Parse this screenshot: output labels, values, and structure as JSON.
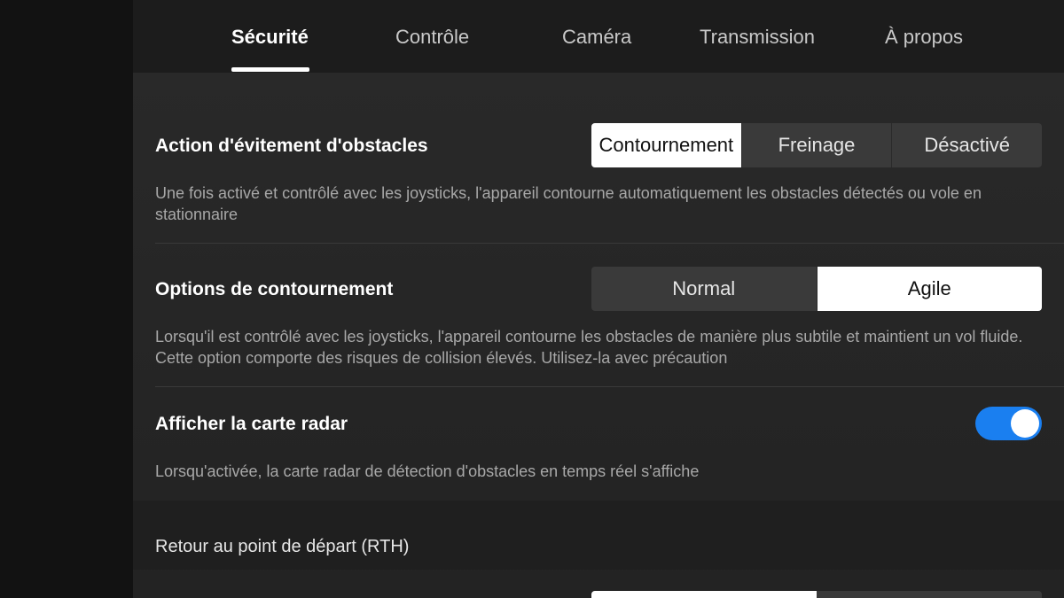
{
  "tabs": [
    {
      "label": "Sécurité",
      "active": true
    },
    {
      "label": "Contrôle",
      "active": false
    },
    {
      "label": "Caméra",
      "active": false
    },
    {
      "label": "Transmission",
      "active": false
    },
    {
      "label": "À propos",
      "active": false
    }
  ],
  "obstacle_action": {
    "title": "Action d'évitement d'obstacles",
    "options": [
      "Contournement",
      "Freinage",
      "Désactivé"
    ],
    "selected": "Contournement",
    "description": "Une fois activé et contrôlé avec les joysticks, l'appareil contourne automatiquement les obstacles détectés ou vole en stationnaire"
  },
  "bypass_options": {
    "title": "Options de contournement",
    "options": [
      "Normal",
      "Agile"
    ],
    "selected": "Agile",
    "description": "Lorsqu'il est contrôlé avec les joysticks, l'appareil contourne les obstacles de manière plus subtile et maintient un vol fluide. Cette option comporte des risques de collision élevés. Utilisez-la avec précaution"
  },
  "radar_map": {
    "title": "Afficher la carte radar",
    "enabled": true,
    "description": "Lorsqu'activée, la carte radar de détection d'obstacles en temps réel s'affiche"
  },
  "rth_section": {
    "label": "Retour au point de départ (RTH)"
  },
  "colors": {
    "accent": "#1a7ff0",
    "selected_segment": "#ffffff"
  }
}
